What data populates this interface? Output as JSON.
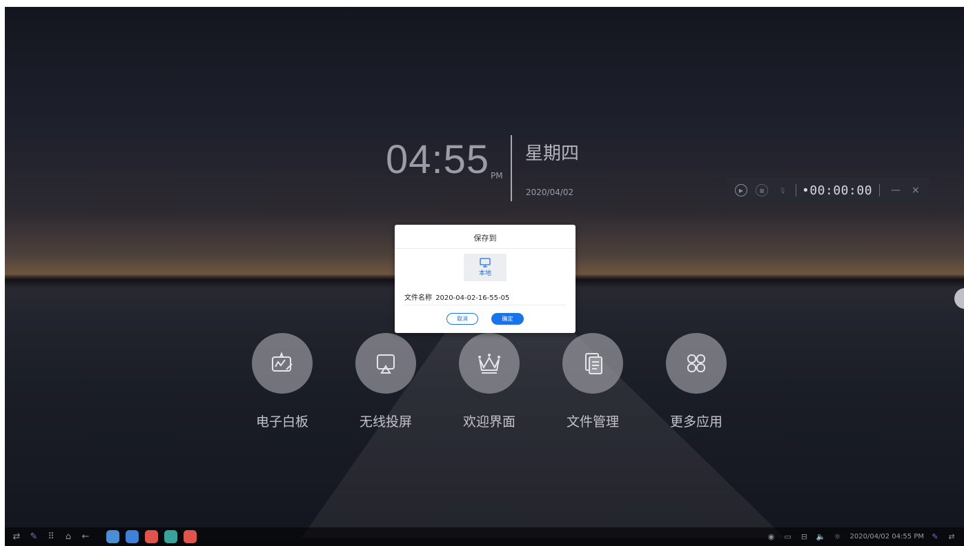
{
  "clock": {
    "time": "04:55",
    "ampm": "PM",
    "weekday": "星期四",
    "date": "2020/04/02"
  },
  "recorder": {
    "timer": "•00:00:00",
    "play_icon": "play-circle-icon",
    "stop_icon": "stop-circle-icon",
    "mic_icon": "mic-off-icon",
    "minimize": "—",
    "close": "×"
  },
  "apps": [
    {
      "label": "电子白板",
      "icon": "whiteboard-icon"
    },
    {
      "label": "无线投屏",
      "icon": "screencast-icon"
    },
    {
      "label": "欢迎界面",
      "icon": "crown-icon"
    },
    {
      "label": "文件管理",
      "icon": "file-manager-icon"
    },
    {
      "label": "更多应用",
      "icon": "apps-grid-icon"
    }
  ],
  "dialog": {
    "title": "保存到",
    "storage_option": "本地",
    "filename_label": "文件名称",
    "filename_value": "2020-04-02-16-55-05",
    "cancel_label": "取消",
    "ok_label": "确定"
  },
  "taskbar": {
    "tray_datetime": "2020/04/02  04:55 PM",
    "apps": [
      {
        "color": "#4a8fd6"
      },
      {
        "color": "#3f80d8"
      },
      {
        "color": "#e0544b"
      },
      {
        "color": "#3aa29a"
      },
      {
        "color": "#e0544b"
      }
    ]
  },
  "colors": {
    "accent": "#1a73e8"
  }
}
